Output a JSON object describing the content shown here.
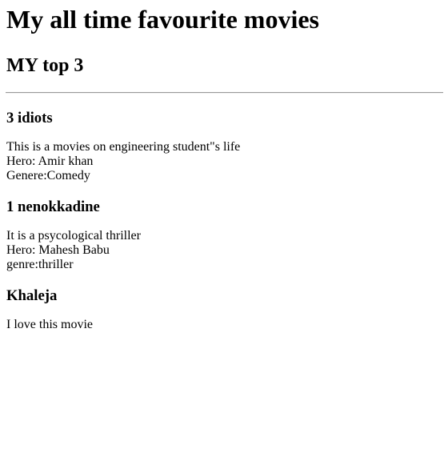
{
  "page": {
    "title": "My all time favourite movies",
    "subtitle": "MY top 3"
  },
  "movies": [
    {
      "name": "3 idiots",
      "lines": [
        "This is a movies on engineering student\"s life",
        "Hero: Amir khan",
        "Genere:Comedy"
      ]
    },
    {
      "name": "1 nenokkadine",
      "lines": [
        "It is a psycological thriller",
        "Hero: Mahesh Babu",
        "genre:thriller"
      ]
    },
    {
      "name": "Khaleja",
      "lines": [
        "I love this movie"
      ]
    }
  ]
}
